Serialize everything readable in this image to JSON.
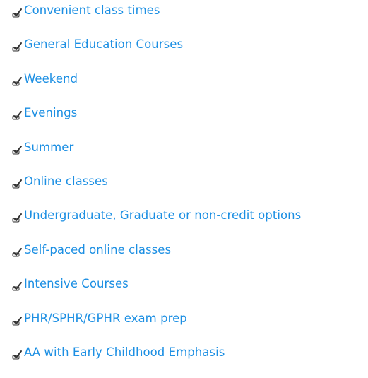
{
  "items": [
    {
      "label": "Convenient class times",
      "icon": "checkmark-bullet-icon"
    },
    {
      "label": "General Education Courses",
      "icon": "checkmark-bullet-icon"
    },
    {
      "label": "Weekend",
      "icon": "checkmark-bullet-icon"
    },
    {
      "label": "Evenings",
      "icon": "checkmark-bullet-icon"
    },
    {
      "label": "Summer",
      "icon": "checkmark-bullet-icon"
    },
    {
      "label": "Online classes",
      "icon": "checkmark-bullet-icon"
    },
    {
      "label": "Undergraduate, Graduate or non-credit options",
      "icon": "checkmark-bullet-icon"
    },
    {
      "label": "Self-paced online classes",
      "icon": "checkmark-bullet-icon"
    },
    {
      "label": "Intensive Courses",
      "icon": "checkmark-bullet-icon"
    },
    {
      "label": "PHR/SPHR/GPHR exam prep",
      "icon": "checkmark-bullet-icon"
    },
    {
      "label": "AA with Early Childhood Emphasis",
      "icon": "checkmark-bullet-icon"
    }
  ],
  "colors": {
    "link": "#1c8fe3",
    "icon_dark": "#333333",
    "icon_light": "#e6e6e6"
  }
}
